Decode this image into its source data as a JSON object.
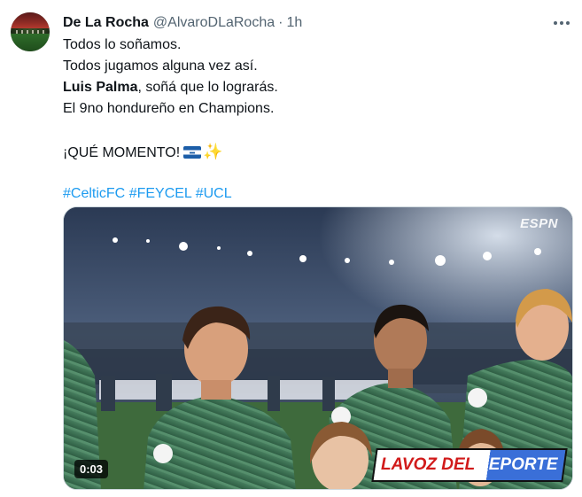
{
  "author": {
    "display_name": "De La Rocha",
    "handle": "@AlvaroDLaRocha",
    "separator": "·",
    "time": "1h"
  },
  "icons": {
    "more": "more-horizontal-icon",
    "flag": "honduras-flag-emoji",
    "sparkle": "sparkles-emoji"
  },
  "tweet": {
    "line1": "Todos lo soñamos.",
    "line2": "Todos jugamos alguna vez así.",
    "line3_bold": "Luis Palma",
    "line3_rest": ", soñá que lo lograrás.",
    "line4": "El 9no hondureño en Champions.",
    "line5": "¡QUÉ MOMENTO!",
    "sparkle_glyph": "✨",
    "hashtags": [
      "#CelticFC",
      "#FEYCEL",
      "#UCL"
    ]
  },
  "media": {
    "broadcaster": "ESPN",
    "duration": "0:03",
    "brand_part1": "LAVOZ DEL",
    "brand_part2": "DEPORTE"
  },
  "colors": {
    "link": "#1d9bf0",
    "secondary_text": "#536471",
    "jersey_green": "#3f7a5a"
  }
}
